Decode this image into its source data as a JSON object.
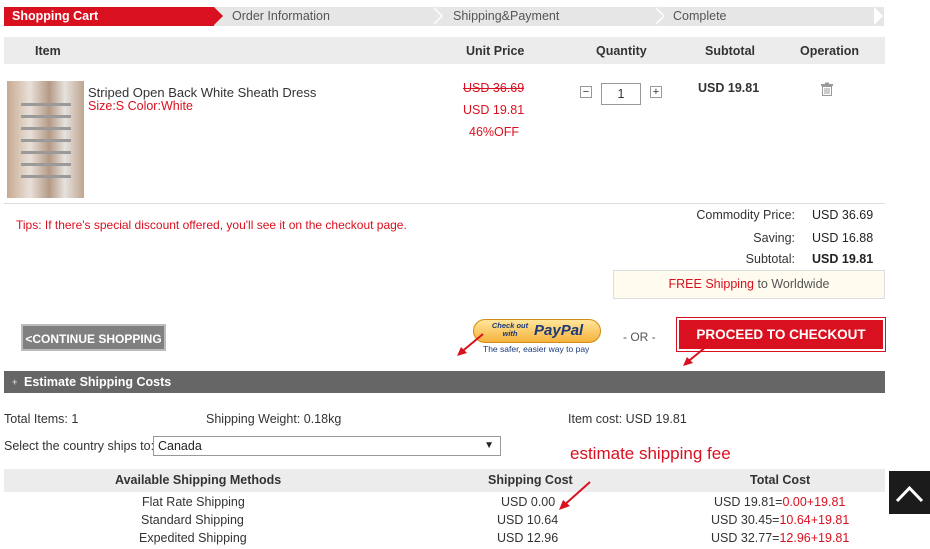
{
  "steps": [
    "Shopping Cart",
    "Order Information",
    "Shipping&Payment",
    "Complete"
  ],
  "table_headers": {
    "item": "Item",
    "unit_price": "Unit Price",
    "quantity": "Quantity",
    "subtotal": "Subtotal",
    "operation": "Operation"
  },
  "product": {
    "name": "Striped Open Back White Sheath Dress",
    "attrs": "Size:S Color:White",
    "original_price": "USD 36.69",
    "price": "USD 19.81",
    "discount": "46%OFF",
    "quantity": "1",
    "subtotal": "USD 19.81",
    "minus": "−",
    "plus": "+"
  },
  "tips": "Tips: If there's special discount offered, you'll see it on the checkout page.",
  "summary": {
    "commodity_label": "Commodity Price:",
    "commodity_value": "USD 36.69",
    "saving_label": "Saving:",
    "saving_value": "USD 16.88",
    "subtotal_label": "Subtotal:",
    "subtotal_value": "USD 19.81"
  },
  "free_shipping": {
    "highlight": "FREE Shipping",
    "rest": " to Worldwide"
  },
  "buttons": {
    "continue": "<CONTINUE SHOPPING",
    "paypal_check": "Check out",
    "paypal_with": "with",
    "paypal_brand": "PayPal",
    "paypal_tag": "The safer, easier way to pay",
    "or": "- OR -",
    "checkout": "PROCEED TO CHECKOUT"
  },
  "estimate": {
    "bar_title": "Estimate Shipping Costs",
    "total_items": "Total Items: 1",
    "shipping_weight": "Shipping Weight: 0.18kg",
    "item_cost": "Item cost: USD 19.81",
    "country_label": "Select the country ships to:",
    "country_value": "Canada",
    "annotation": "estimate shipping fee"
  },
  "methods_header": {
    "method": "Available Shipping Methods",
    "cost": "Shipping Cost",
    "total": "Total Cost"
  },
  "methods": [
    {
      "name": "Flat Rate Shipping",
      "cost": "USD 0.00",
      "total_a": "USD 19.81=",
      "total_b": "0.00",
      "total_c": "+19.81"
    },
    {
      "name": "Standard Shipping",
      "cost": "USD 10.64",
      "total_a": "USD 30.45=",
      "total_b": "10.64",
      "total_c": "+19.81"
    },
    {
      "name": "Expedited Shipping",
      "cost": "USD 12.96",
      "total_a": "USD 32.77=",
      "total_b": "12.96",
      "total_c": "+19.81"
    }
  ],
  "colors": {
    "accent": "#d9101f",
    "bar": "#666666",
    "header_bg": "#ececec"
  }
}
